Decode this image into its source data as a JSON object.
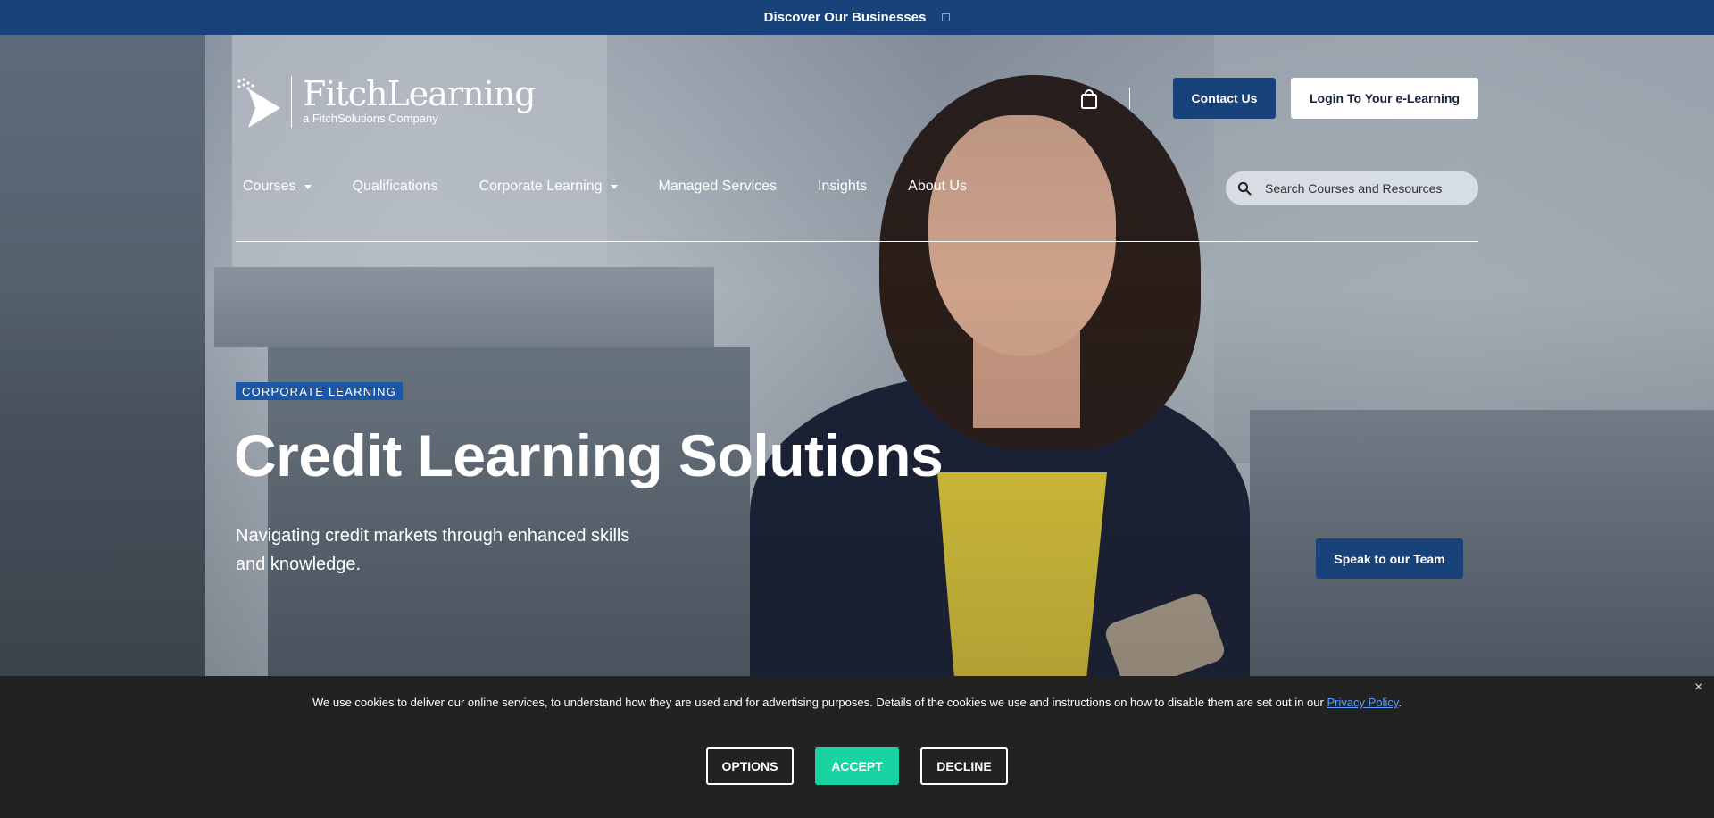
{
  "topbar": {
    "label": "Discover Our Businesses"
  },
  "header": {
    "logo_title": "FitchLearning",
    "logo_sub": "a FitchSolutions Company",
    "contact_label": "Contact Us",
    "login_label": "Login To Your e-Learning"
  },
  "nav": {
    "items": [
      {
        "label": "Courses",
        "dropdown": true
      },
      {
        "label": "Qualifications",
        "dropdown": false
      },
      {
        "label": "Corporate Learning",
        "dropdown": true
      },
      {
        "label": "Managed Services",
        "dropdown": false
      },
      {
        "label": "Insights",
        "dropdown": false
      },
      {
        "label": "About Us",
        "dropdown": false
      }
    ],
    "search_placeholder": "Search Courses and Resources"
  },
  "hero": {
    "badge": "CORPORATE LEARNING",
    "title": "Credit Learning Solutions",
    "subtitle": "Navigating credit markets through enhanced skills and knowledge.",
    "cta": "Speak to our Team"
  },
  "cookie": {
    "text": "We use cookies to deliver our online services, to understand how they are used and for advertising purposes. Details of the cookies we use and instructions on how to disable them are set out in our ",
    "link": "Privacy Policy",
    "end": ".",
    "close": "×",
    "options": "OPTIONS",
    "accept": "ACCEPT",
    "decline": "DECLINE"
  },
  "colors": {
    "brand_blue": "#17427a",
    "badge_blue": "#1c57a6",
    "accept_green": "#19d4a2",
    "cookie_bg": "#222222"
  },
  "icons": [
    "chevron-down-icon",
    "logo-arrow-icon",
    "shopping-bag-icon",
    "search-icon",
    "close-icon"
  ]
}
